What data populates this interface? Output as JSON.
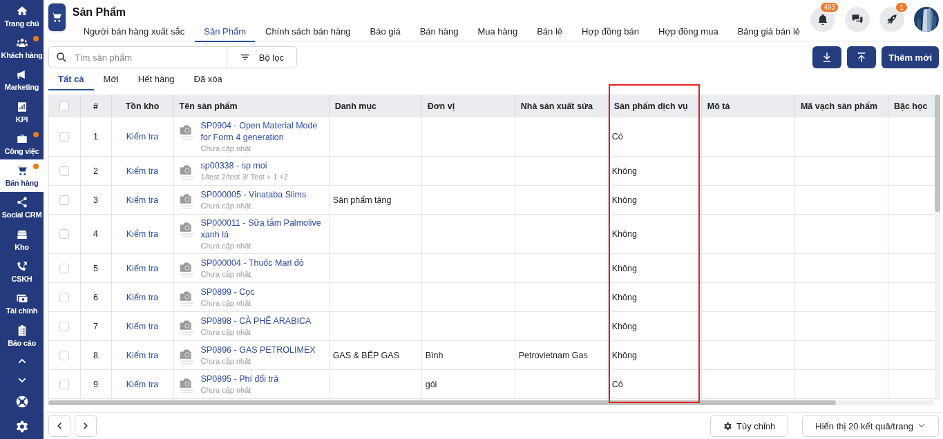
{
  "sidebar": {
    "items": [
      {
        "label": "Trang chủ",
        "selected": false,
        "notification": false
      },
      {
        "label": "Khách hàng",
        "selected": false,
        "notification": true
      },
      {
        "label": "Marketing",
        "selected": false,
        "notification": false
      },
      {
        "label": "KPI",
        "selected": false,
        "notification": false
      },
      {
        "label": "Công việc",
        "selected": false,
        "notification": true
      },
      {
        "label": "Bán hàng",
        "selected": true,
        "notification": true
      },
      {
        "label": "Social CRM",
        "selected": false,
        "notification": false
      },
      {
        "label": "Kho",
        "selected": false,
        "notification": false
      },
      {
        "label": "CSKH",
        "selected": false,
        "notification": false
      },
      {
        "label": "Tài chính",
        "selected": false,
        "notification": false
      },
      {
        "label": "Báo cáo",
        "selected": false,
        "notification": false
      }
    ]
  },
  "header": {
    "title": "Sản Phẩm",
    "tabs": [
      {
        "label": "Người bán hàng xuất sắc",
        "selected": false
      },
      {
        "label": "Sản Phẩm",
        "selected": true
      },
      {
        "label": "Chính sách bán hàng",
        "selected": false
      },
      {
        "label": "Báo giá",
        "selected": false
      },
      {
        "label": "Bán hàng",
        "selected": false
      },
      {
        "label": "Mua hàng",
        "selected": false
      },
      {
        "label": "Bán lẻ",
        "selected": false
      },
      {
        "label": "Hợp đồng bán",
        "selected": false
      },
      {
        "label": "Hợp đồng mua",
        "selected": false
      },
      {
        "label": "Bảng giá bán lẻ",
        "selected": false
      }
    ],
    "actions": [
      {
        "kind": "bell",
        "badge": "493"
      },
      {
        "kind": "chat"
      },
      {
        "kind": "rocket",
        "badge": "1"
      }
    ]
  },
  "toolbar": {
    "search": {
      "placeholder": "Tìm sản phẩm"
    },
    "filter_button": "Bộ lọc",
    "add_button": "Thêm mới"
  },
  "filter_tabs": [
    {
      "label": "Tất cả",
      "selected": true
    },
    {
      "label": "Mới",
      "selected": false
    },
    {
      "label": "Hết hàng",
      "selected": false
    },
    {
      "label": "Đã xóa",
      "selected": false
    }
  ],
  "table": {
    "select_all": {
      "checked": false
    },
    "columns": [
      {
        "label": "#",
        "highlighted": false
      },
      {
        "label": "Tồn kho",
        "highlighted": false
      },
      {
        "label": "Tên sản phẩm",
        "highlighted": false
      },
      {
        "label": "Danh mục",
        "highlighted": false
      },
      {
        "label": "Đơn vị",
        "highlighted": false
      },
      {
        "label": "Nhà sản xuất sửa",
        "highlighted": false
      },
      {
        "label": "Sản phẩm dịch vụ",
        "highlighted": true
      },
      {
        "label": "Mô tả",
        "highlighted": false
      },
      {
        "label": "Mã vạch sản phẩm",
        "highlighted": false
      },
      {
        "label": "Bậc học",
        "highlighted": false
      }
    ],
    "rows": [
      {
        "checked": false,
        "index": "1",
        "stock": "Kiểm tra",
        "name": "SP0904 - Open Material Mode for Form 4 generation",
        "detail": "Chưa cập nhật",
        "service": "Có"
      },
      {
        "checked": false,
        "index": "2",
        "stock": "Kiểm tra",
        "name": "sp00338 - sp moi",
        "detail": "1/test 2/test 3/ Test + 1 +2",
        "service": "Không"
      },
      {
        "checked": false,
        "index": "3",
        "stock": "Kiểm tra",
        "name": "SP000005 - Vinataba Slims",
        "detail": "Chưa cập nhật",
        "category": "Sản phẩm tặng",
        "service": "Không"
      },
      {
        "checked": false,
        "index": "4",
        "stock": "Kiểm tra",
        "name": "SP000011 - Sữa tắm Palmolive xanh lá",
        "detail": "Chưa cập nhật",
        "service": "Không"
      },
      {
        "checked": false,
        "index": "5",
        "stock": "Kiểm tra",
        "name": "SP000004 - Thuốc Marl đỏ",
        "detail": "Chưa cập nhật",
        "service": "Không"
      },
      {
        "checked": false,
        "index": "6",
        "stock": "Kiểm tra",
        "name": "SP0899 - Cọc",
        "detail": "Chưa cập nhật",
        "service": "Không"
      },
      {
        "checked": false,
        "index": "7",
        "stock": "Kiểm tra",
        "name": "SP0898 - CÀ PHÊ ARABICA",
        "detail": "Chưa cập nhật",
        "service": "Không"
      },
      {
        "checked": false,
        "index": "8",
        "stock": "Kiểm tra",
        "name": "SP0896 - GAS PETROLIMEX",
        "detail": "Chưa cập nhật",
        "category": "GAS & BẾP GAS",
        "unit": "Bình",
        "manufacturer": "Petrovietnam Gas",
        "service": "Không"
      },
      {
        "checked": false,
        "index": "9",
        "stock": "Kiểm tra",
        "name": "SP0895 - Phí đổi trả",
        "detail": "Chưa cập nhật",
        "unit": "gói",
        "service": "Có"
      }
    ]
  },
  "footer": {
    "customize_button": "Tùy chỉnh",
    "page_size": "Hiển thị 20 kết quả/trang"
  }
}
